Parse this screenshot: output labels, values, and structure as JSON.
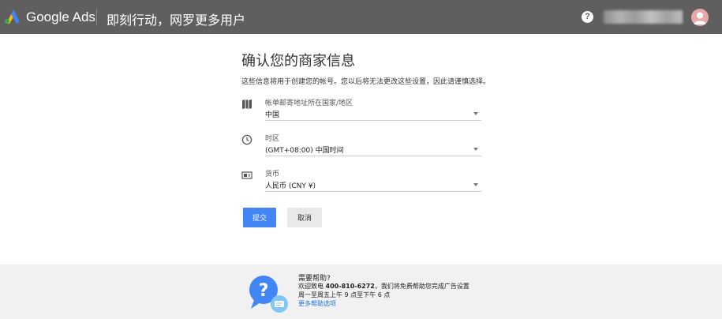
{
  "header": {
    "brand": "Google Ads",
    "tagline": "即刻行动，网罗更多用户",
    "help_icon": "question-circle-icon",
    "logo_colors": {
      "yellow": "#fbbc04",
      "blue": "#4285f4",
      "green": "#34a853"
    }
  },
  "main": {
    "title": "确认您的商家信息",
    "subtitle": "这些信息将用于创建您的帐号。您以后将无法更改这些设置，因此请谨慎选择。",
    "fields": [
      {
        "icon": "map-icon",
        "label": "帐单邮寄地址所在国家/地区",
        "value": "中国"
      },
      {
        "icon": "clock-icon",
        "label": "时区",
        "value": "(GMT+08:00) 中国时间"
      },
      {
        "icon": "currency-card-icon",
        "label": "货币",
        "value": "人民币 (CNY ¥)"
      }
    ],
    "submit_label": "提交",
    "cancel_label": "取消",
    "accent_color": "#4285f4"
  },
  "footer": {
    "title": "需要帮助?",
    "line1_prefix": "欢迎致电 ",
    "phone": "400-810-6272",
    "line1_suffix": "，我们将免费帮助您完成广告设置",
    "line2": "周一至周五上午 9 点至下午 6 点",
    "link": "更多帮助选项"
  }
}
